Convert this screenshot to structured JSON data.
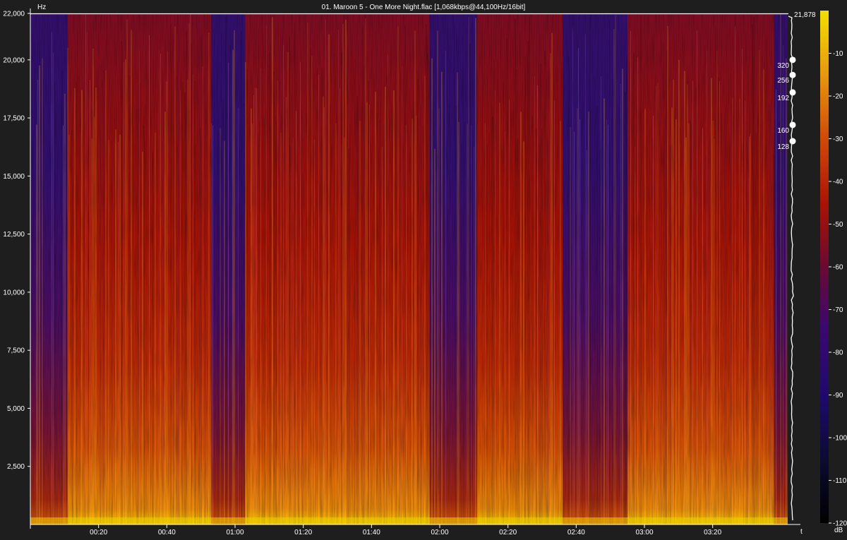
{
  "window": {
    "title": "01. Maroon 5 - One More Night.flac [1,068kbps@44,100Hz/16bit]"
  },
  "chart_data": {
    "type": "heatmap",
    "title": "01. Maroon 5 - One More Night.flac [1,068kbps@44,100Hz/16bit]",
    "ylabel": "Hz",
    "xlabel": "t",
    "ylim": [
      0,
      22000
    ],
    "xlim_seconds": [
      0,
      222
    ],
    "y_ticks": [
      {
        "value": 2500,
        "label": "2,500"
      },
      {
        "value": 5000,
        "label": "5,000"
      },
      {
        "value": 7500,
        "label": "7,500"
      },
      {
        "value": 10000,
        "label": "10,000"
      },
      {
        "value": 12500,
        "label": "12,500"
      },
      {
        "value": 15000,
        "label": "15,000"
      },
      {
        "value": 17500,
        "label": "17,500"
      },
      {
        "value": 20000,
        "label": "20,000"
      },
      {
        "value": 22000,
        "label": "22,000"
      }
    ],
    "x_ticks": [
      {
        "value": 20,
        "label": "00:20"
      },
      {
        "value": 40,
        "label": "00:40"
      },
      {
        "value": 60,
        "label": "01:00"
      },
      {
        "value": 80,
        "label": "01:20"
      },
      {
        "value": 100,
        "label": "01:40"
      },
      {
        "value": 120,
        "label": "02:00"
      },
      {
        "value": 140,
        "label": "02:20"
      },
      {
        "value": 160,
        "label": "02:40"
      },
      {
        "value": 180,
        "label": "03:00"
      },
      {
        "value": 200,
        "label": "03:20"
      }
    ],
    "cutoff": {
      "value": 21878,
      "label": "21,878"
    },
    "bitrate_markers": [
      {
        "label": "320",
        "freq": 20000
      },
      {
        "label": "256",
        "freq": 19350
      },
      {
        "label": "192",
        "freq": 18600
      },
      {
        "label": "160",
        "freq": 17200
      },
      {
        "label": "128",
        "freq": 16500
      }
    ],
    "quiet_sections_seconds": [
      [
        0,
        11
      ],
      [
        53,
        63
      ],
      [
        117,
        131
      ],
      [
        156,
        175
      ],
      [
        218,
        222
      ]
    ],
    "colorbar": {
      "unit": "dB",
      "range": [
        -120,
        0
      ],
      "ticks": [
        "-10",
        "-20",
        "-30",
        "-40",
        "-50",
        "-60",
        "-70",
        "-80",
        "-90",
        "-100",
        "-110",
        "-120"
      ],
      "colors": [
        "#f2e000",
        "#e89a10",
        "#cf4a08",
        "#a81206",
        "#6a0a32",
        "#3b0870",
        "#1e0a6e",
        "#0c0a30",
        "#000000"
      ]
    }
  }
}
